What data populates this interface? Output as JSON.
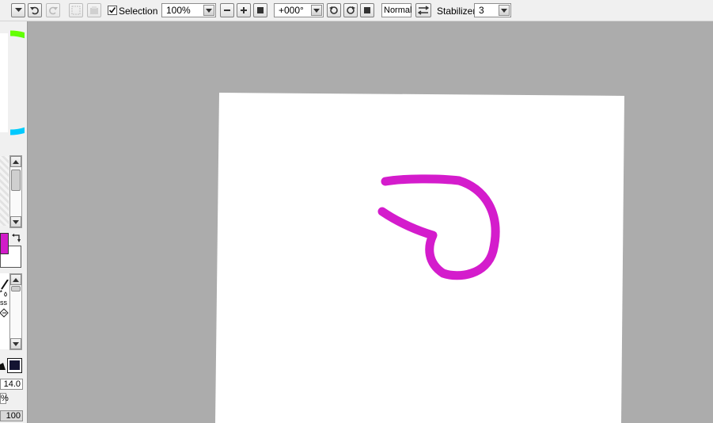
{
  "toolbar": {
    "selection_label": "Selection",
    "selection_checked": true,
    "zoom_value": "100%",
    "rotation_value": "+000°",
    "blend_mode": "Normal",
    "stabilizer_label": "Stabilizer",
    "stabilizer_value": "3"
  },
  "left_panel": {
    "brush_size_value": "14.0",
    "density_value": "100",
    "partial_brush_label": "ss",
    "partial_percent": "%"
  },
  "colors": {
    "foreground": "#d11bc8",
    "background": "#ffffff",
    "stroke": "#d41ccc",
    "canvas_bg": "#acacac",
    "paper": "#ffffff"
  }
}
